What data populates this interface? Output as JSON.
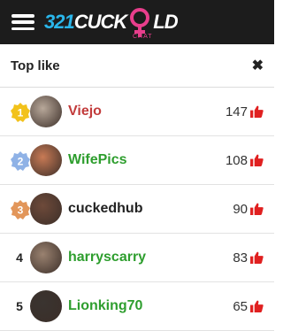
{
  "app": {
    "logo_num": "321",
    "logo_word": "CUCK",
    "logo_tail": "LD",
    "logo_sub": "CHAT"
  },
  "panel": {
    "title": "Top like"
  },
  "colors": {
    "topbar": "#1c1c1c",
    "logo_blue": "#2ab6ea",
    "logo_pink": "#e83e8c",
    "like_red": "#e02020",
    "name_red": "#c23b3b",
    "name_green": "#2e9e2e",
    "name_dark": "#222222"
  },
  "users": [
    {
      "rank": "1",
      "badge": "gold-medal-icon",
      "name": "Viejo",
      "name_color": "#c23b3b",
      "likes": "147",
      "avatar_color": "#b8a89a"
    },
    {
      "rank": "2",
      "badge": "silver-medal-icon",
      "name": "WifePics",
      "name_color": "#2e9e2e",
      "likes": "108",
      "avatar_color": "#c87a55"
    },
    {
      "rank": "3",
      "badge": "bronze-medal-icon",
      "name": "cuckedhub",
      "name_color": "#222222",
      "likes": "90",
      "avatar_color": "#6e4a3a"
    },
    {
      "rank": "4",
      "badge": "",
      "name": "harryscarry",
      "name_color": "#2e9e2e",
      "likes": "83",
      "avatar_color": "#9a8270"
    },
    {
      "rank": "5",
      "badge": "",
      "name": "Lionking70",
      "name_color": "#2e9e2e",
      "likes": "65",
      "avatar_color": "#3a3430"
    }
  ]
}
